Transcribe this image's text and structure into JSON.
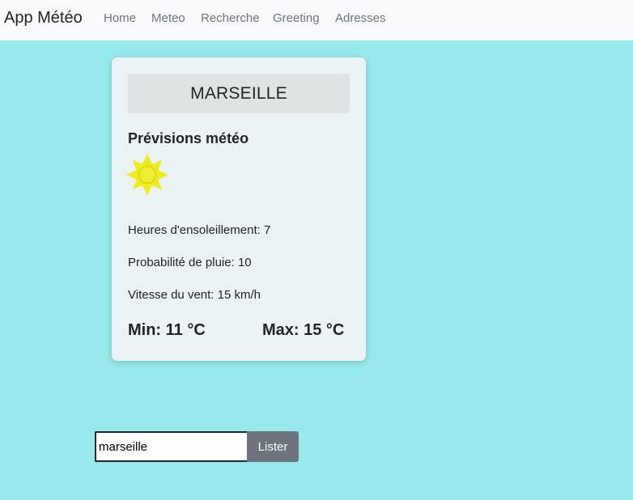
{
  "navbar": {
    "brand": "App Météo",
    "links": [
      {
        "label": "Home"
      },
      {
        "label": "Meteo"
      },
      {
        "label": "Recherche"
      },
      {
        "label": "Greeting"
      },
      {
        "label": "Adresses"
      }
    ]
  },
  "weather_card": {
    "city": "MARSEILLE",
    "title": "Prévisions météo",
    "icon": "sun-icon",
    "sunshine": {
      "label": "Heures d'ensoleillement: ",
      "value": "7"
    },
    "rain": {
      "label": "Probabilité de pluie: ",
      "value": "10"
    },
    "wind": {
      "label": "Vitesse du vent: ",
      "value": "15 km/h"
    },
    "min": "Min: 11 °C",
    "max": "Max: 15 °C"
  },
  "search": {
    "value": "marseille",
    "button_label": "Lister"
  },
  "colors": {
    "background": "#97e9eb",
    "navbar": "#f8f9fa",
    "card": "#eaf2f4",
    "sun": "#f0ec1a",
    "button": "#6c757d"
  }
}
